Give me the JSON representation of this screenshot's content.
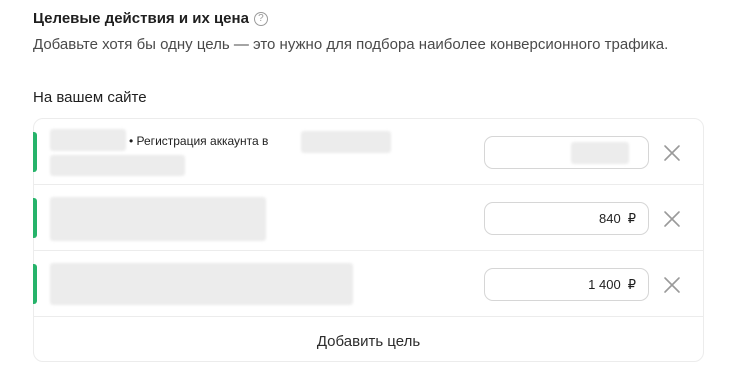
{
  "header": {
    "title": "Целевые действия и их цена",
    "help_icon": "?"
  },
  "description": "Добавьте хотя бы одну цель — это нужно для подбора наиболее конверсионного трафика.",
  "section_label": "На вашем сайте",
  "goals": [
    {
      "text": "• Регистрация аккаунта в",
      "price": "",
      "currency": ""
    },
    {
      "text": "",
      "price": "840",
      "currency": "₽"
    },
    {
      "text": "",
      "price": "1 400",
      "currency": "₽"
    }
  ],
  "add_goal_label": "Добавить цель",
  "colors": {
    "accent": "#26b36a",
    "border": "#ececec",
    "input_border": "#d6d6d6",
    "icon": "#9a9a9a"
  },
  "icons": {
    "help": "help-icon",
    "remove": "close-icon"
  }
}
